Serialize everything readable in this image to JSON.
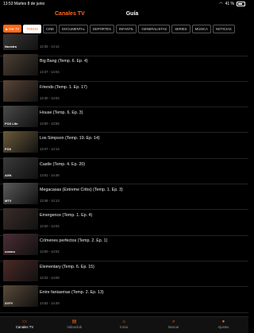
{
  "status_bar": {
    "time": "13:53",
    "date": "Martes 8 de junio",
    "battery": "41 %"
  },
  "header": {
    "app_title": "Canales TV",
    "page_title": "Guía"
  },
  "filters": {
    "my_tv": "Mis TV",
    "chips": [
      "TODOS",
      "CINE",
      "DOCUMENTAL",
      "DEPORTES",
      "INFANTIL",
      "GENERALISTAS",
      "SERIES",
      "MÚSICA",
      "NOTICIAS"
    ],
    "active_index": 0
  },
  "programs": [
    {
      "title": "",
      "time": "12:25 - 14:12",
      "channel_logo": "Nuestra",
      "thumb_color": "#3b3a36"
    },
    {
      "title": "Big Bang (Temp. 6. Ep. 4)",
      "time": "13:37 - 14:04",
      "channel_logo": "",
      "thumb_color": "#4c3f34"
    },
    {
      "title": "Friends (Temp. 1. Ep. 17)",
      "time": "13:40 - 14:04",
      "channel_logo": "",
      "thumb_color": "#5a4636"
    },
    {
      "title": "House (Temp. 6. Ep. 3)",
      "time": "13:00 - 13:55",
      "channel_logo": "FOX Life",
      "thumb_color": "#4a4a4a"
    },
    {
      "title": "Los Simpson (Temp. 19. Ep. 14)",
      "time": "13:47 - 14:14",
      "channel_logo": "FOX",
      "thumb_color": "#6a5a3a"
    },
    {
      "title": "Castle (Temp. 4. Ep. 20)",
      "time": "13:51 - 14:46",
      "channel_logo": "AXN",
      "thumb_color": "#3a3a3a"
    },
    {
      "title": "Megacasas (Extreme Cribs) (Temp. 1. Ep. 3)",
      "time": "13:46 - 14:13",
      "channel_logo": "MTV",
      "thumb_color": "#5a5a5a"
    },
    {
      "title": "Emergence (Temp. 1. Ep. 4)",
      "time": "13:20 - 14:02",
      "channel_logo": "",
      "thumb_color": "#3a2d2a"
    },
    {
      "title": "Crímenes perfectos (Temp. 2. Ep. 1)",
      "time": "13:00 - 14:02",
      "channel_logo": "cosmo",
      "thumb_color": "#4a2e35"
    },
    {
      "title": "Elementary (Temp. 6. Ep. 15)",
      "time": "13:22 - 14:08",
      "channel_logo": "",
      "thumb_color": "#4b2a26"
    },
    {
      "title": "Entre fantasmas (Temp. 2. Ep. 13)",
      "time": "13:52 - 14:49",
      "channel_logo": "SYFY",
      "thumb_color": "#5a4a3a"
    }
  ],
  "tabbar": {
    "tabs": [
      {
        "label": "Canales TV",
        "icon": "tv-icon"
      },
      {
        "label": "Videoclub",
        "icon": "film-icon"
      },
      {
        "label": "Inicio",
        "icon": "home-icon"
      },
      {
        "label": "Buscar",
        "icon": "search-icon"
      },
      {
        "label": "Ajustes",
        "icon": "user-icon"
      }
    ],
    "active_index": 0
  },
  "accent_color": "#ff6a1a"
}
